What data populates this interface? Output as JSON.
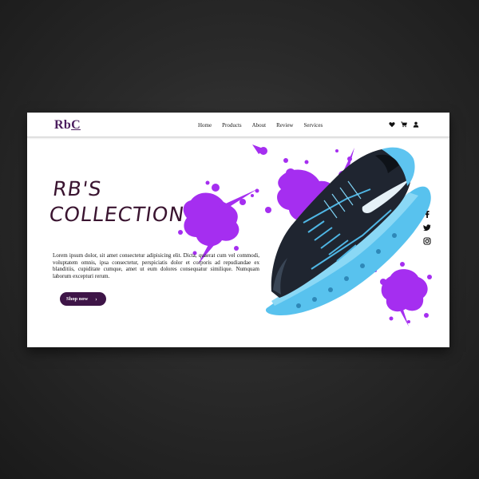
{
  "brand": {
    "logo_main": "Rb",
    "logo_last": "C"
  },
  "nav": {
    "links": [
      "Home",
      "Products",
      "About",
      "Review",
      "Services"
    ],
    "icons": [
      "heart-icon",
      "cart-icon",
      "user-icon"
    ]
  },
  "hero": {
    "title_line1": "RB'S",
    "title_line2": "COLLECTION",
    "body": "Lorem ipsum dolor, sit amet consectetur adipisicing elit. Dicta, quaerat cum vel commodi, voluptatem omnis, ipsa consectetur, perspiciatis dolor et corporis ad repudiandae ex blanditiis, cupiditate cumque, amet ut eum dolores consequatur similique. Numquam laborum excepturi rerum.",
    "cta_label": "Shop now",
    "cta_chevron": "›"
  },
  "social": {
    "icons": [
      "facebook-icon",
      "twitter-icon",
      "instagram-icon"
    ]
  },
  "colors": {
    "brand_purple": "#4b1d5e",
    "button_purple": "#3e1547",
    "splash_purple": "#a52ef0",
    "shoe_blue": "#5ec4f0"
  }
}
